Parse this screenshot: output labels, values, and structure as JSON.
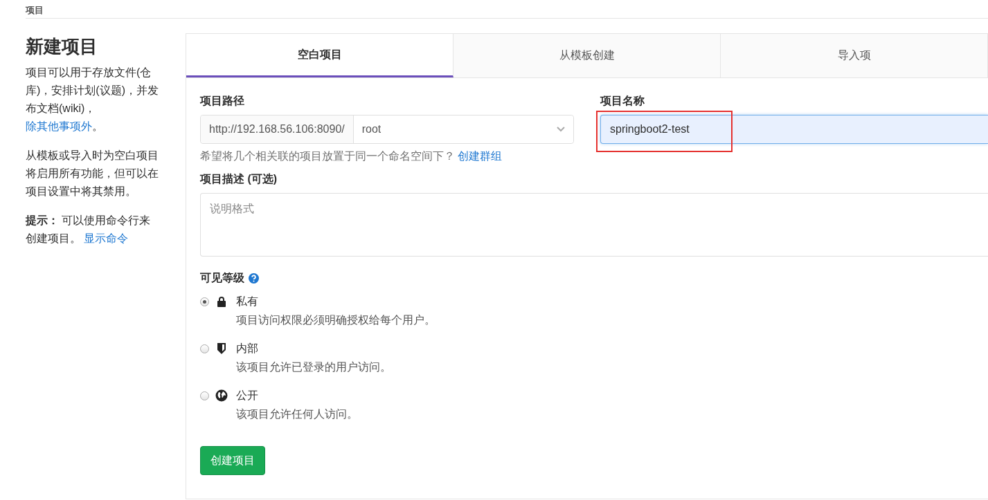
{
  "breadcrumb": "项目",
  "intro": {
    "title": "新建项目",
    "paragraph_1": "项目可以用于存放文件(仓库)，安排计划(议题)，并发布文档(wiki)，",
    "paragraph_1_link": "除其他事项外",
    "paragraph_1_end": "。",
    "paragraph_2": "从模板或导入时为空白项目将启用所有功能，但可以在项目设置中将其禁用。",
    "tip_label": "提示：",
    "tip_text": "可以使用命令行来创建项目。",
    "tip_link": "显示命令"
  },
  "tabs": [
    {
      "label": "空白项目",
      "selected": true
    },
    {
      "label": "从模板创建",
      "selected": false
    },
    {
      "label": "导入项",
      "selected": false
    }
  ],
  "form": {
    "path_label": "项目路径",
    "path_prefix": "http://192.168.56.106:8090/",
    "namespace": "root",
    "name_label": "项目名称",
    "name_value": "springboot2-test",
    "help_text": "希望将几个相关联的项目放置于同一个命名空间下？",
    "help_link": "创建群组",
    "description_label": "项目描述 (可选)",
    "description_placeholder": "说明格式",
    "visibility_label": "可见等级",
    "visibility_options": [
      {
        "kind": "private",
        "label": "私有",
        "description": "项目访问权限必须明确授权给每个用户。",
        "selected": true
      },
      {
        "kind": "internal",
        "label": "内部",
        "description": "该项目允许已登录的用户访问。",
        "selected": false
      },
      {
        "kind": "public",
        "label": "公开",
        "description": "该项目允许任何人访问。",
        "selected": false
      }
    ],
    "submit": "创建项目"
  }
}
